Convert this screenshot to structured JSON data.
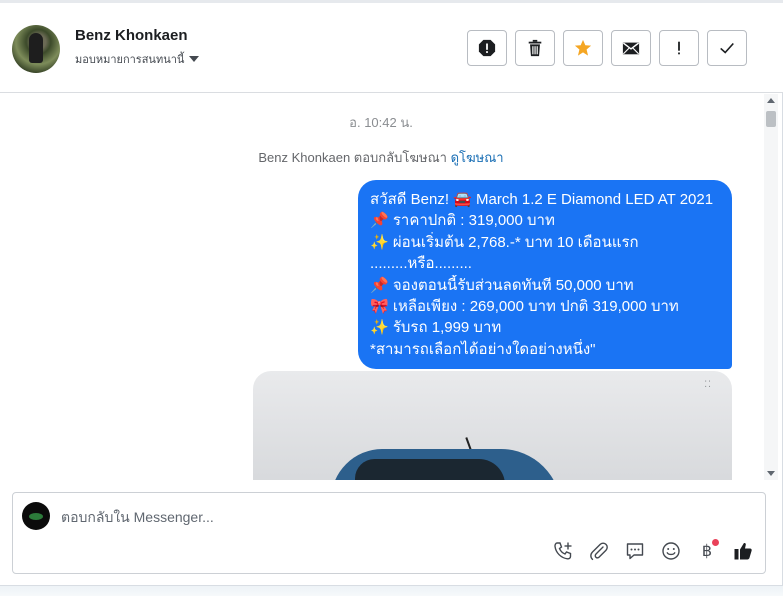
{
  "header": {
    "name": "Benz Khonkaen",
    "assign_label": "มอบหมายการสนทนานี้"
  },
  "actions": [
    {
      "name": "spam-icon"
    },
    {
      "name": "trash-icon"
    },
    {
      "name": "star-icon",
      "color": "#f5a623"
    },
    {
      "name": "mail-icon"
    },
    {
      "name": "follow-up-icon"
    },
    {
      "name": "check-icon"
    }
  ],
  "thread": {
    "timestamp": "อ. 10:42 น.",
    "reply_text": "Benz Khonkaen ตอบกลับโฆษณา",
    "reply_link": "ดูโฆษณา",
    "message_lines": [
      "สวัสดี Benz! 🚘 March 1.2 E Diamond LED AT 2021",
      "📌 ราคาปกติ : 319,000 บาท",
      "✨ ผ่อนเริ่มต้น 2,768.-* บาท 10 เดือนแรก",
      ".........หรือ.........",
      "📌 จองตอนนี้รับส่วนลดทันที 50,000 บาท",
      "🎀 เหลือเพียง : 269,000 บาท ปกติ 319,000 บาท",
      "✨ รับรถ 1,999 บาท",
      "*สามารถเลือกได้อย่างใดอย่างหนึ่ง\""
    ],
    "bubble_color": "#1a74f4"
  },
  "composer": {
    "placeholder": "ตอบกลับใน Messenger...",
    "baht_symbol": "฿"
  }
}
